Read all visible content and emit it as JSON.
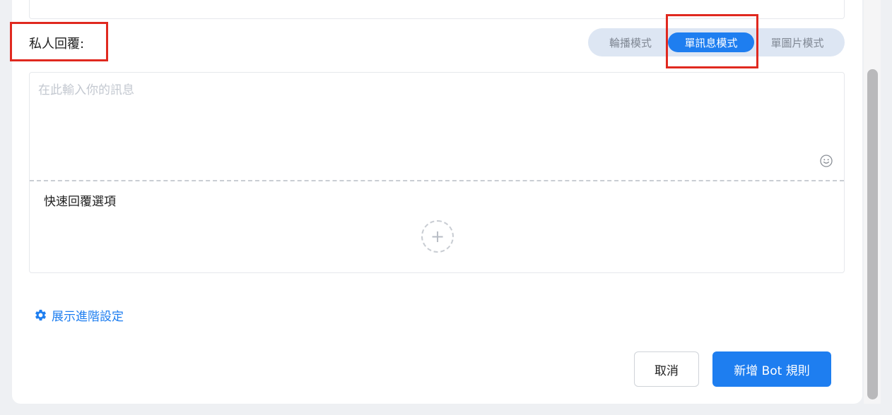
{
  "private_reply": {
    "label": "私人回覆:"
  },
  "mode_switch": {
    "options": [
      "輪播模式",
      "單訊息模式",
      "單圖片模式"
    ],
    "selected": "單訊息模式"
  },
  "message_editor": {
    "placeholder": "在此輸入你的訊息",
    "value": "",
    "emoji_icon": "smiley-icon"
  },
  "quick_reply": {
    "label": "快速回覆選項",
    "add_icon": "plus-icon"
  },
  "advanced": {
    "label": "展示進階設定",
    "icon": "gear-icon"
  },
  "footer": {
    "cancel_label": "取消",
    "submit_label": "新增 Bot 規則"
  },
  "colors": {
    "accent": "#1e7ef0",
    "highlight": "#e0291f"
  }
}
